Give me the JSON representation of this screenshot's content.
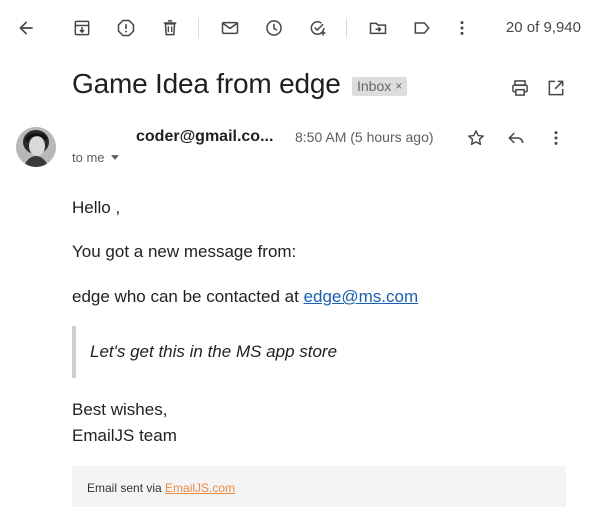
{
  "toolbar": {
    "icons": [
      "back-arrow-icon",
      "archive-icon",
      "report-spam-icon",
      "delete-icon",
      "mark-unread-icon",
      "snooze-icon",
      "add-task-icon",
      "move-to-icon",
      "label-icon",
      "more-vert-icon"
    ],
    "pager": "20 of 9,940"
  },
  "thread": {
    "subject": "Game Idea from edge",
    "label": "Inbox",
    "label_close": "×"
  },
  "message": {
    "sender": "coder@gmail.co...",
    "time": "8:50 AM (5 hours ago)",
    "recipient": "to me"
  },
  "body": {
    "greeting": "Hello ,",
    "line1": "You got a new message from:",
    "line2_prefix": "edge who can be contacted at ",
    "email_link": "edge@ms.com",
    "quote": "Let's get this in the MS app store",
    "signoff": "Best wishes,",
    "team": "EmailJS team"
  },
  "footer": {
    "prefix": "Email sent via ",
    "link": "EmailJS.com"
  },
  "colors": {
    "link": "#1a5fb4",
    "footer_link": "#e88a4a",
    "chip_bg": "#dddddd"
  }
}
